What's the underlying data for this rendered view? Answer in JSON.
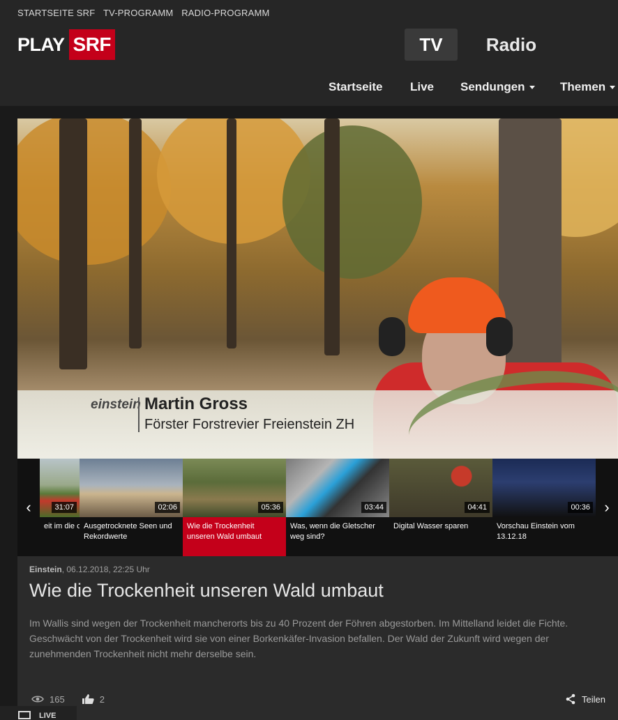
{
  "top_links": [
    "STARTSEITE SRF",
    "TV-PROGRAMM",
    "RADIO-PROGRAMM"
  ],
  "logo": {
    "play": "PLAY",
    "srf": "SRF"
  },
  "tabs": {
    "tv": "TV",
    "radio": "Radio"
  },
  "nav": [
    "Startseite",
    "Live",
    "Sendungen",
    "Themen"
  ],
  "player": {
    "brand": "einstein",
    "name": "Martin Gross",
    "role": "Förster Forstrevier Freienstein ZH"
  },
  "playlist": [
    {
      "duration": "31:07",
      "title": "eit im die chweiz"
    },
    {
      "duration": "02:06",
      "title": "Ausgetrocknete Seen und Rekordwerte"
    },
    {
      "duration": "05:36",
      "title": "Wie die Trockenheit unseren Wald umbaut",
      "active": true
    },
    {
      "duration": "03:44",
      "title": "Was, wenn die Gletscher weg sind?"
    },
    {
      "duration": "04:41",
      "title": "Digital Wasser sparen"
    },
    {
      "duration": "00:36",
      "title": "Vorschau Einstein vom 13.12.18"
    }
  ],
  "video": {
    "show": "Einstein",
    "date": ", 06.12.2018, 22:25 Uhr",
    "title": "Wie die Trockenheit unseren Wald umbaut",
    "description": "Im Wallis sind wegen der Trockenheit mancherorts bis zu 40 Prozent der Föhren abgestorben. Im Mittelland leidet die Fichte. Geschwächt von der Trockenheit wird sie von einer Borkenkäfer-Invasion befallen. Der Wald der Zukunft wird wegen der zunehmenden Trockenheit nicht mehr derselbe sein.",
    "views": "165",
    "likes": "2",
    "share_label": "Teilen"
  },
  "live_label": "LIVE",
  "colors": {
    "accent": "#c4001a"
  }
}
